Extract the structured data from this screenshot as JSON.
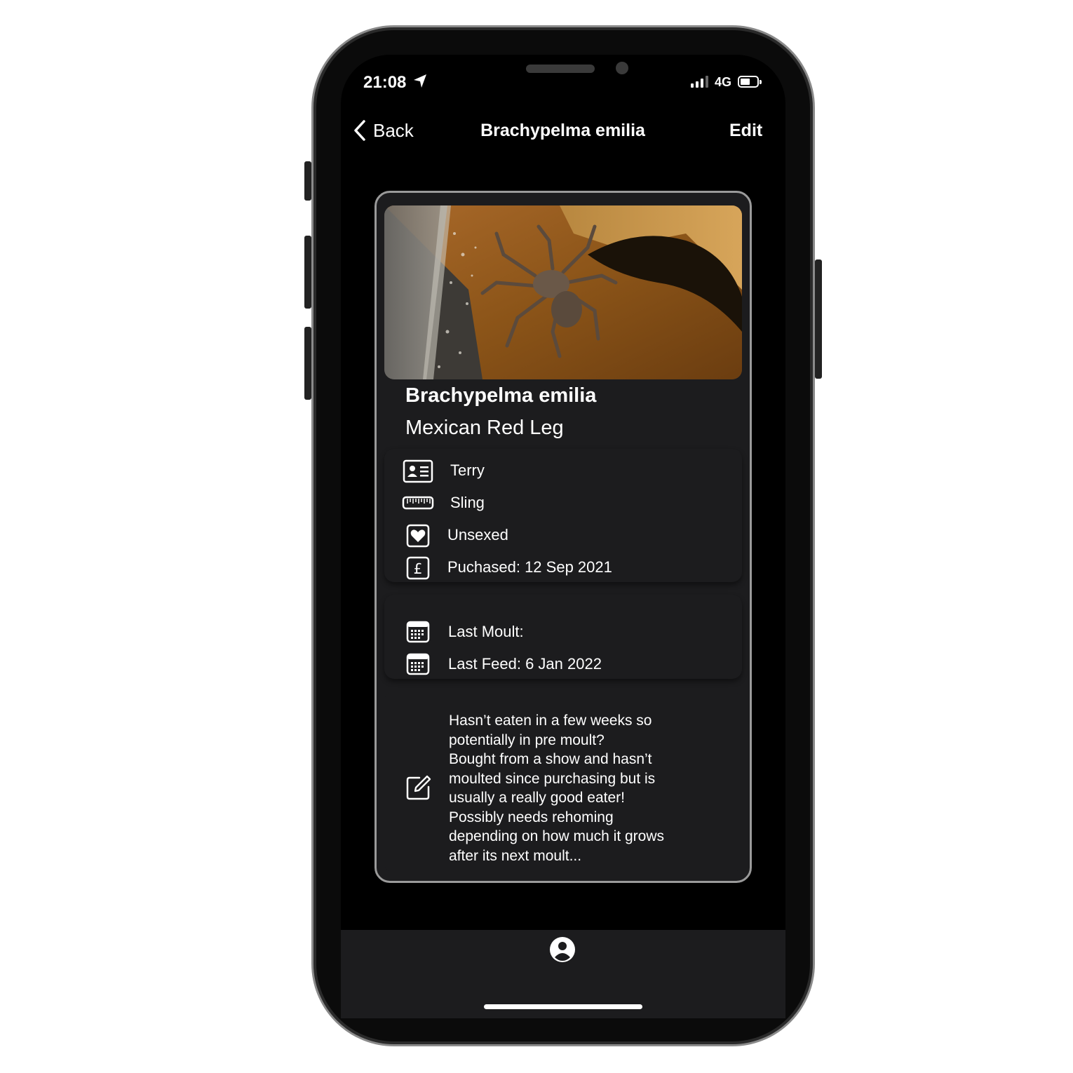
{
  "status_bar": {
    "time": "21:08",
    "network": "4G",
    "signal_bars": 3,
    "battery_level": 0.45
  },
  "nav": {
    "back_label": "Back",
    "title": "Brachypelma emilia",
    "edit_label": "Edit"
  },
  "profile": {
    "species": "Brachypelma emilia",
    "common_name": "Mexican Red Leg",
    "photo_alt": "Tarantula on substrate"
  },
  "details": {
    "name": "Terry",
    "size": "Sling",
    "sex": "Unsexed",
    "purchased": "Puchased: 12 Sep 2021",
    "icons": [
      "id-card-icon",
      "ruler-icon",
      "heart-icon",
      "pound-icon"
    ]
  },
  "dates": {
    "last_moult": "Last Moult:",
    "last_feed": "Last Feed: 6 Jan 2022",
    "icons": [
      "calendar-icon",
      "calendar-icon"
    ]
  },
  "notes": {
    "text": "Hasn’t eaten in a few weeks so\npotentially in pre moult?\nBought from a show and hasn’t\nmoulted since purchasing but is\nusually a really good eater!\nPossibly needs rehoming\ndepending on how much it grows\nafter its next moult...",
    "icon": "edit-icon"
  },
  "tab_bar": {
    "icons": [
      "profile-icon"
    ]
  }
}
